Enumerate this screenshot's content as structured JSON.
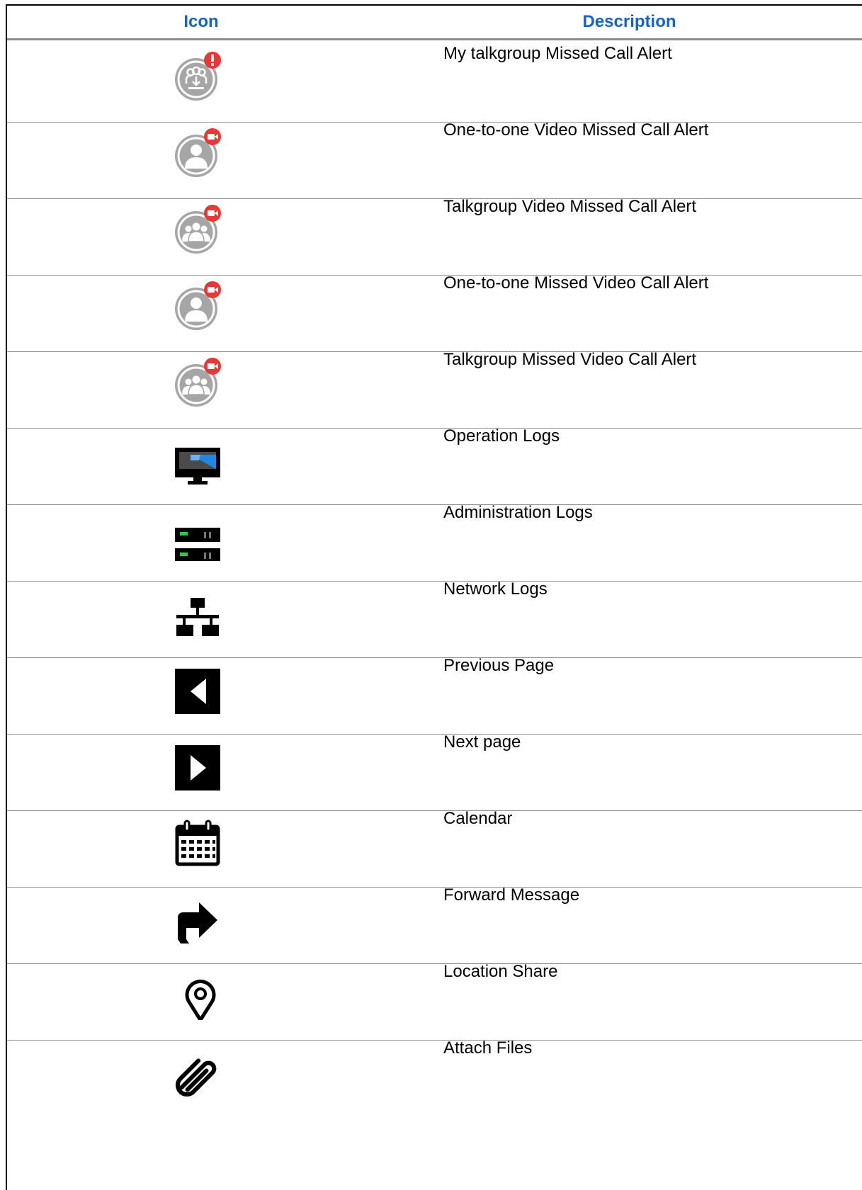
{
  "table": {
    "headers": {
      "icon": "Icon",
      "description": "Description"
    },
    "rows": [
      {
        "icon": "talkgroup-missed-call-alert-icon",
        "description": "My talkgroup Missed Call Alert"
      },
      {
        "icon": "one-to-one-video-missed-call-alert-icon",
        "description": "One-to-one Video Missed Call Alert"
      },
      {
        "icon": "talkgroup-video-missed-call-alert-icon",
        "description": "Talkgroup Video Missed Call Alert"
      },
      {
        "icon": "one-to-one-missed-video-call-alert-icon",
        "description": "One-to-one Missed Video Call Alert"
      },
      {
        "icon": "talkgroup-missed-video-call-alert-icon",
        "description": "Talkgroup Missed Video Call Alert"
      },
      {
        "icon": "monitor-icon",
        "description": "Operation Logs"
      },
      {
        "icon": "server-icon",
        "description": "Administration Logs"
      },
      {
        "icon": "network-icon",
        "description": "Network Logs"
      },
      {
        "icon": "previous-page-icon",
        "description": "Previous Page"
      },
      {
        "icon": "next-page-icon",
        "description": "Next page"
      },
      {
        "icon": "calendar-icon",
        "description": "Calendar"
      },
      {
        "icon": "forward-arrow-icon",
        "description": "Forward Message"
      },
      {
        "icon": "location-pin-icon",
        "description": "Location Share"
      },
      {
        "icon": "paperclip-icon",
        "description": "Attach Files"
      }
    ]
  },
  "colors": {
    "header_text": "#1565c0",
    "alert_red": "#e53935",
    "icon_gray": "#a6a6a6",
    "log_green": "#2ecc40",
    "monitor_blue": "#1e88e5"
  }
}
